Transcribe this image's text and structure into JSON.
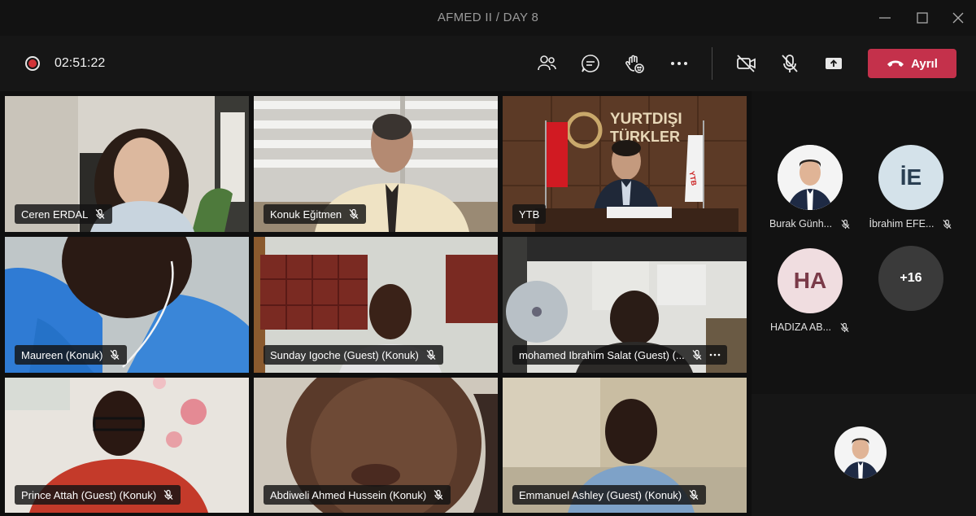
{
  "window": {
    "title": "AFMED II / DAY 8"
  },
  "toolbar": {
    "timer": "02:51:22",
    "leave_label": "Ayrıl",
    "leave_color": "#c4314b",
    "icons": [
      "people-icon",
      "chat-icon",
      "raise-hand-icon",
      "more-icon",
      "camera-off-icon",
      "mic-off-icon",
      "share-icon",
      "phone-icon"
    ]
  },
  "tiles": [
    {
      "name": "Ceren ERDAL"
    },
    {
      "name": "Konuk Eğitmen"
    },
    {
      "name": "YTB"
    },
    {
      "name": "Maureen (Konuk)"
    },
    {
      "name": "Sunday Igoche (Guest) (Konuk)"
    },
    {
      "name": "mohamed Ibrahim Salat (Guest) (..."
    },
    {
      "name": "Prince Attah (Guest) (Konuk)"
    },
    {
      "name": "Abdiweli Ahmed Hussein (Konuk)"
    },
    {
      "name": "Emmanuel Ashley (Guest) (Konuk)"
    }
  ],
  "scene_text": {
    "ytb_sign_1": "YURTDIŞI",
    "ytb_sign_2": "TÜRKLER",
    "ytb_flag": "YTB"
  },
  "side_panel": {
    "participants": [
      {
        "name": "Burak Günh...",
        "initials": ""
      },
      {
        "name": "İbrahim EFE...",
        "initials": "İE"
      },
      {
        "name": "HADIZA AB...",
        "initials": "HA"
      }
    ],
    "more_count": "+16"
  },
  "colors": {
    "accent": "#8b8cc7",
    "danger": "#c4314b",
    "ie_avatar": "#d4e2ea",
    "ha_avatar": "#f0dde0"
  }
}
